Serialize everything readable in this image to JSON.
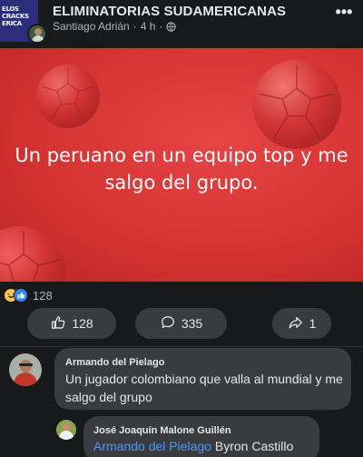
{
  "post": {
    "group_name": "ELIMINATORIAS SUDAMERICANAS",
    "author": "Santiago Adrián",
    "separator": "·",
    "time": "4 h",
    "separator2": "·",
    "more_label": "•••",
    "group_avatar_text": [
      "ELOS",
      "CRACKS",
      "ERICA"
    ],
    "image_caption_line1": "Un peruano en un equipo top y me",
    "image_caption_line2": "salgo del grupo.",
    "reaction_count": "128",
    "icons": [
      "globe-icon",
      "more-icon",
      "haha-reaction-icon",
      "like-reaction-icon",
      "like-icon",
      "comment-icon",
      "share-icon"
    ]
  },
  "actions": {
    "like_count": "128",
    "comment_count": "335",
    "share_count": "1"
  },
  "comments": [
    {
      "author": "Armando del Pielago",
      "text": "Un jugador colombiano que valla al mundial y me salgo del grupo"
    },
    {
      "author": "José Joaquín Malone Guillén",
      "mention": "Armando del Pielago",
      "text": "Byron Castillo"
    }
  ],
  "colors": {
    "background": "#18191a",
    "bubble": "#3a3b3c",
    "image_red": "#d63333",
    "mention_blue": "#4599ff",
    "like_blue": "#2d88ff"
  }
}
